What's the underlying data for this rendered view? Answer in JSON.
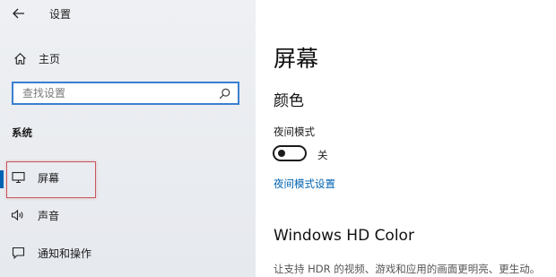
{
  "window": {
    "title": "设置"
  },
  "sidebar": {
    "home_label": "主页",
    "search_placeholder": "查找设置",
    "section_title": "系统",
    "items": [
      {
        "label": "屏幕",
        "icon": "monitor-icon",
        "active": true
      },
      {
        "label": "声音",
        "icon": "speaker-icon",
        "active": false
      },
      {
        "label": "通知和操作",
        "icon": "notification-icon",
        "active": false
      }
    ]
  },
  "main": {
    "page_title": "屏幕",
    "color_heading": "颜色",
    "night_mode_label": "夜间模式",
    "night_mode_state": "关",
    "night_mode_link": "夜间模式设置",
    "hdr_heading": "Windows HD Color",
    "hdr_description": "让支持 HDR 的视频、游戏和应用的画面更明亮、更生动。"
  },
  "colors": {
    "accent": "#0063b1",
    "highlight_annotation": "#c9555a",
    "sidebar_bg": "#eef0f3"
  }
}
